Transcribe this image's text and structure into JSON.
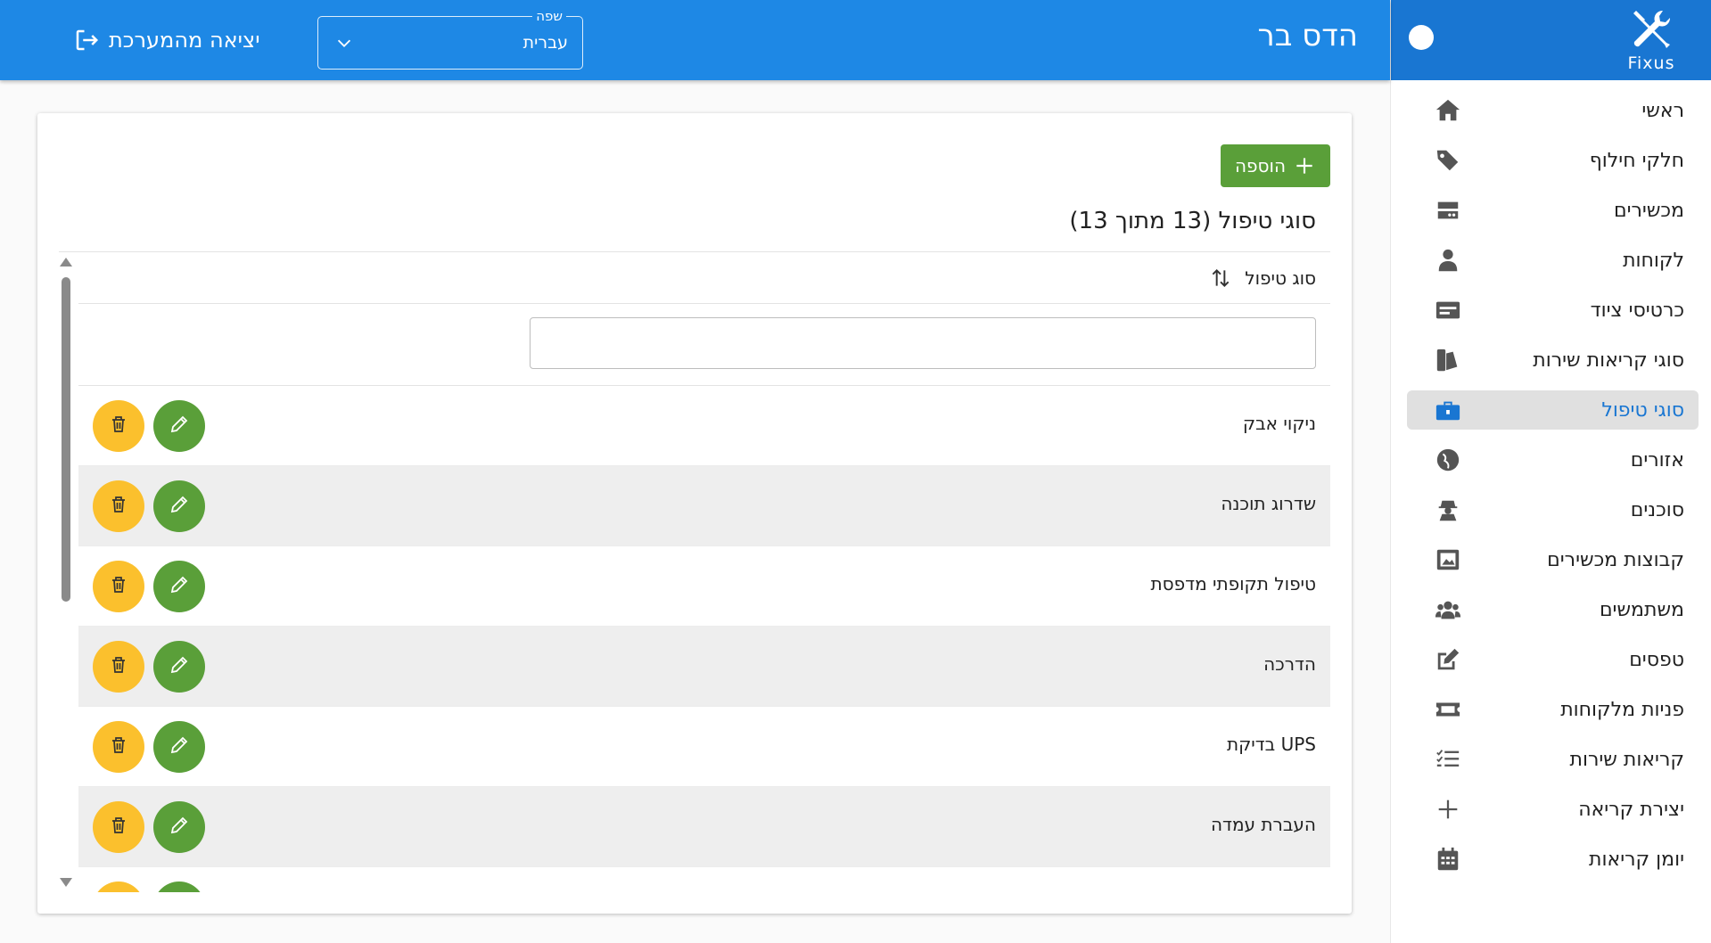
{
  "app": {
    "logo_text": "Fixus",
    "logo_icon": "wrench-screwdriver-icon"
  },
  "header": {
    "user_name": "הדס בר",
    "language": {
      "legend": "שפה",
      "value": "עברית"
    },
    "logout_label": "יציאה מהמערכת",
    "colors": {
      "bar": "#1e88e5",
      "sidebar_head": "#1976d2"
    }
  },
  "sidebar": {
    "items": [
      {
        "label": "ראשי",
        "icon": "home-icon"
      },
      {
        "label": "חלקי חילוף",
        "icon": "tags-icon"
      },
      {
        "label": "מכשירים",
        "icon": "server-icon"
      },
      {
        "label": "לקוחות",
        "icon": "user-tie-icon"
      },
      {
        "label": "כרטיסי ציוד",
        "icon": "id-card-icon"
      },
      {
        "label": "סוגי קריאות שירות",
        "icon": "swatchbook-icon"
      },
      {
        "label": "סוגי טיפול",
        "icon": "toolbox-icon",
        "active": true
      },
      {
        "label": "אזורים",
        "icon": "globe-icon"
      },
      {
        "label": "סוכנים",
        "icon": "user-secret-icon"
      },
      {
        "label": "קבוצות מכשירים",
        "icon": "photo-frame-icon"
      },
      {
        "label": "משתמשים",
        "icon": "users-icon"
      },
      {
        "label": "טפסים",
        "icon": "edit-icon"
      },
      {
        "label": "פניות מלקוחות",
        "icon": "ticket-icon"
      },
      {
        "label": "קריאות שירות",
        "icon": "tasks-icon"
      },
      {
        "label": "יצירת קריאה",
        "icon": "plus-icon"
      },
      {
        "label": "יומן קריאות",
        "icon": "calendar-icon"
      }
    ]
  },
  "main": {
    "add_label": "הוספה",
    "title": "סוגי טיפול (13 מתוך 13)",
    "column_header": "סוג טיפול",
    "filter_value": "",
    "rows": [
      "ניקוי אבק",
      "שדרוג תוכנה",
      "טיפול תקופתי מדפסת",
      "הדרכה",
      "בדיקת UPS",
      "העברת עמדה",
      ""
    ],
    "colors": {
      "edit": "#5a9f39",
      "delete": "#fbc02d",
      "active_nav": "#1976d2"
    }
  }
}
